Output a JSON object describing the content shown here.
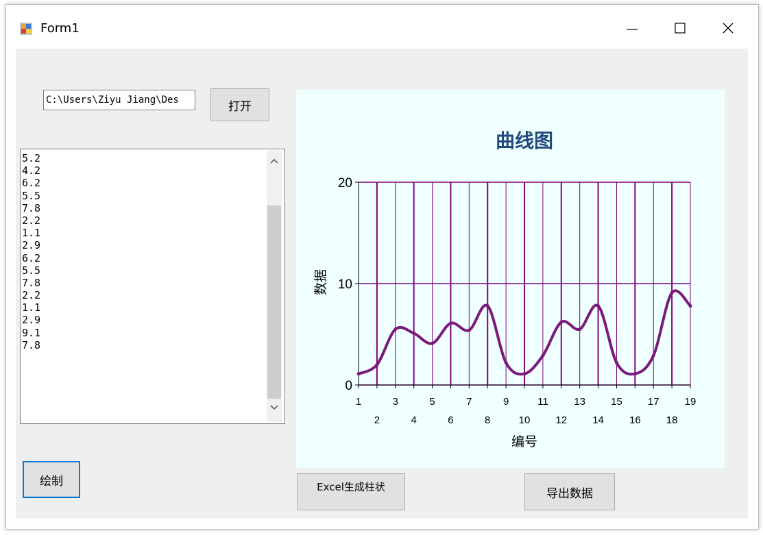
{
  "window": {
    "title": "Form1"
  },
  "path_input": {
    "value": "C:\\Users\\Ziyu Jiang\\Des"
  },
  "buttons": {
    "open": "打开",
    "draw": "绘制",
    "excel_bar": "Excel生成柱状",
    "export": "导出数据"
  },
  "list_values": [
    "5.2",
    "4.2",
    "6.2",
    "5.5",
    "7.8",
    "2.2",
    "1.1",
    "2.9",
    "6.2",
    "5.5",
    "7.8",
    "2.2",
    "1.1",
    "2.9",
    "9.1",
    "7.8"
  ],
  "icons": {
    "app": "form-app-icon",
    "minimize": "minimize-icon",
    "maximize": "maximize-icon",
    "close": "close-icon",
    "scroll_up": "chevron-up-icon",
    "scroll_down": "chevron-down-icon"
  },
  "colors": {
    "accent": "#0078d7",
    "series": "#7a1a7a",
    "grid": "#800080",
    "chart_bg": "#f0ffff",
    "title": "#1f497d"
  },
  "chart_data": {
    "type": "line",
    "title": "曲线图",
    "xlabel": "编号",
    "ylabel": "数据",
    "x": [
      1,
      2,
      3,
      4,
      5,
      6,
      7,
      8,
      9,
      10,
      11,
      12,
      13,
      14,
      15,
      16,
      17,
      18,
      19
    ],
    "series": [
      {
        "values": [
          1.1,
          2.0,
          5.5,
          5.1,
          4.1,
          6.1,
          5.4,
          7.8,
          2.2,
          1.1,
          2.9,
          6.2,
          5.5,
          7.8,
          2.2,
          1.1,
          2.9,
          9.1,
          7.8
        ]
      }
    ],
    "ylim": [
      0,
      20
    ],
    "yticks": [
      0,
      10,
      20
    ],
    "xlim": [
      1,
      19
    ],
    "smooth": true,
    "grid": true,
    "legend": "none"
  }
}
